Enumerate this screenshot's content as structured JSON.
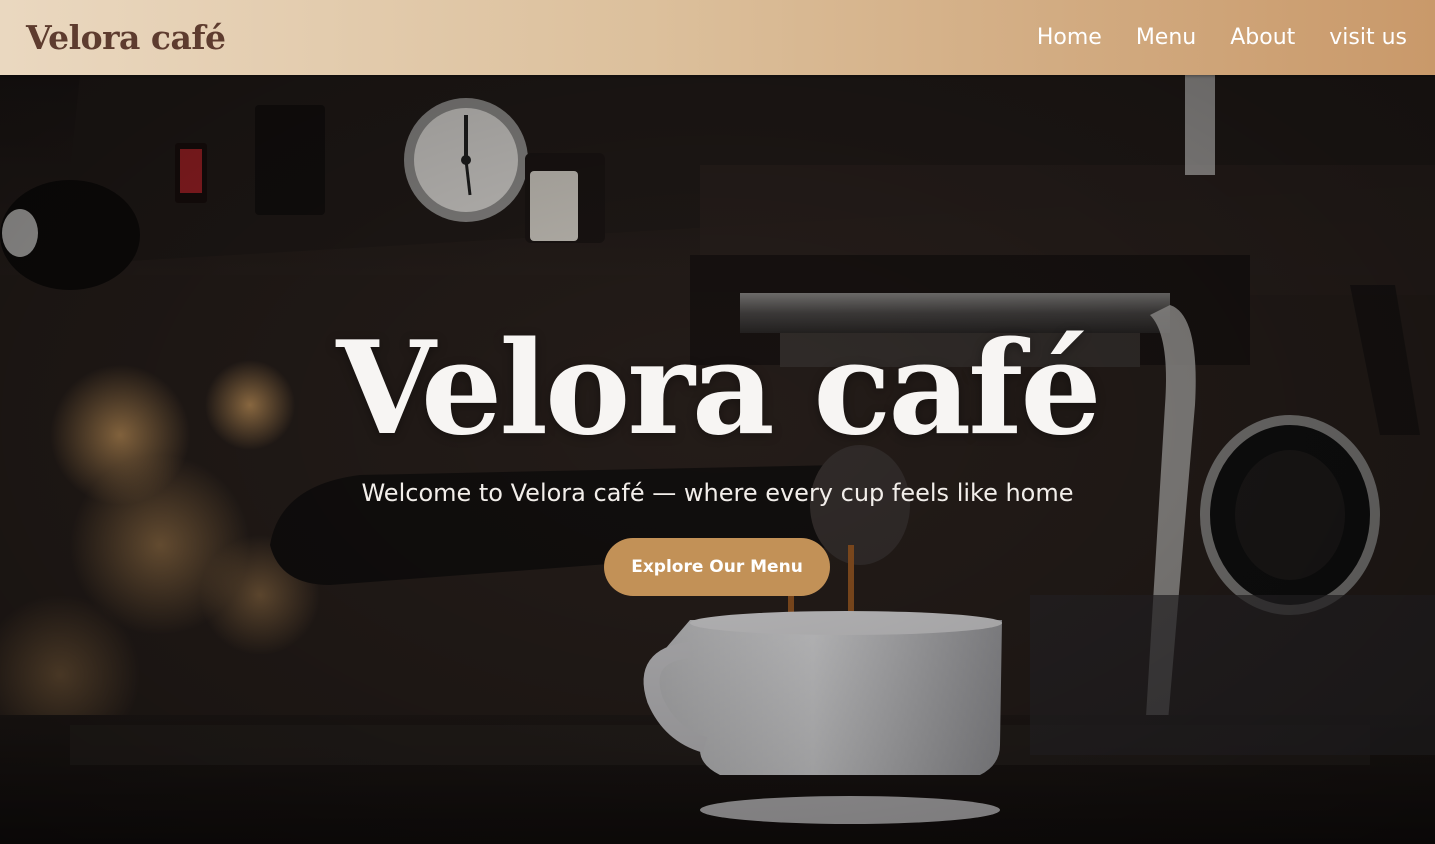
{
  "header": {
    "brand": "Velora café",
    "nav": [
      {
        "label": "Home"
      },
      {
        "label": "Menu"
      },
      {
        "label": "About"
      },
      {
        "label": "visit us"
      }
    ]
  },
  "hero": {
    "title": "Velora café",
    "subtitle": "Welcome to Velora café — where every cup feels like home",
    "cta_label": "Explore Our Menu",
    "background_image": "espresso-machine-pouring-coffee-photo"
  },
  "colors": {
    "header_gradient_start": "#ead8c0",
    "header_gradient_end": "#c9996a",
    "brand_text": "#5e3c2f",
    "nav_text": "#ffffff",
    "hero_title": "#f7f5f3",
    "cta_background": "#c29157",
    "cta_text": "#ffffff"
  }
}
